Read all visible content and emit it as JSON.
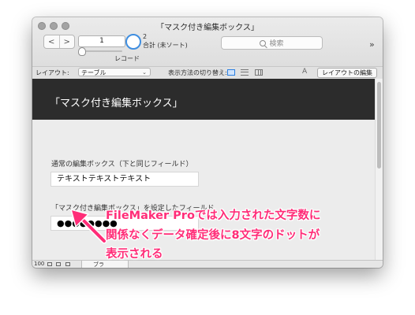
{
  "window": {
    "title": "「マスク付き編集ボックス」"
  },
  "toolbar": {
    "nav_back": "<",
    "nav_forward": ">",
    "record_number": "1",
    "found_count": "2",
    "total_label": "合計 (未ソート)",
    "record_label": "レコード",
    "search_placeholder": "検索",
    "overflow": "»"
  },
  "layout_bar": {
    "layout_label": "レイアウト:",
    "layout_value": "テーブル",
    "view_as_label": "表示方法の切り替え:",
    "aa_icon": "A",
    "edit_layout_button": "レイアウトの編集"
  },
  "header": {
    "title": "「マスク付き編集ボックス」"
  },
  "fields": {
    "normal_label": "通常の編集ボックス（下と同じフィールド）",
    "normal_value": "テキストテキストテキスト",
    "masked_label": "「マスク付き編集ボックス」を設定したフィールド",
    "masked_value": "●●●●●●●●"
  },
  "status_bar": {
    "zoom": "100",
    "mode": "ブラ"
  },
  "annotation": {
    "line1": "FileMaker Proでは入力された文字数に",
    "line2": "関係なくデータ確定後に8文字のドットが",
    "line3": "表示される"
  },
  "colors": {
    "header_band": "#2c2c2c",
    "annotation": "#ff2d78",
    "accent": "#3f8ee0"
  }
}
